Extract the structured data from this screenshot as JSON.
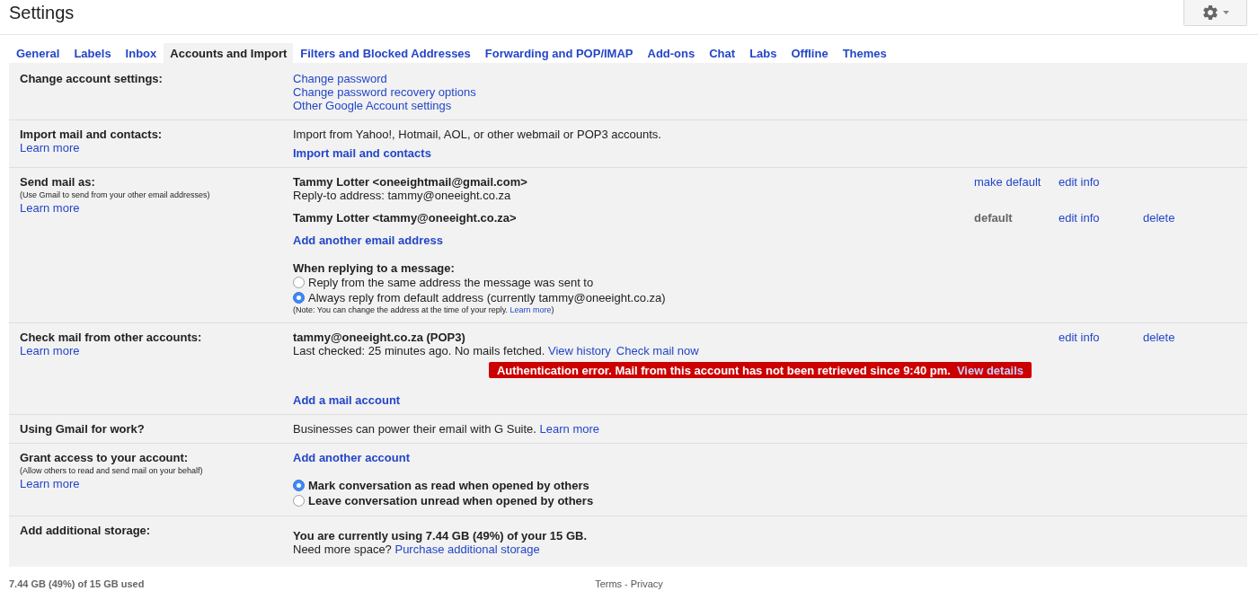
{
  "header": {
    "title": "Settings"
  },
  "tabs": [
    {
      "label": "General",
      "selected": false
    },
    {
      "label": "Labels",
      "selected": false
    },
    {
      "label": "Inbox",
      "selected": false
    },
    {
      "label": "Accounts and Import",
      "selected": true
    },
    {
      "label": "Filters and Blocked Addresses",
      "selected": false
    },
    {
      "label": "Forwarding and POP/IMAP",
      "selected": false
    },
    {
      "label": "Add-ons",
      "selected": false
    },
    {
      "label": "Chat",
      "selected": false
    },
    {
      "label": "Labs",
      "selected": false
    },
    {
      "label": "Offline",
      "selected": false
    },
    {
      "label": "Themes",
      "selected": false
    }
  ],
  "sections": [
    {
      "kind": "links",
      "label": "Change account settings:",
      "links": [
        "Change password",
        "Change password recovery options",
        "Other Google Account settings"
      ]
    },
    {
      "kind": "import",
      "label": "Import mail and contacts:",
      "learn_more": "Learn more",
      "text": "Import from Yahoo!, Hotmail, AOL, or other webmail or POP3 accounts.",
      "action": "Import mail and contacts"
    },
    {
      "kind": "send_as",
      "label": "Send mail as:",
      "note": "(Use Gmail to send from your other email addresses)",
      "learn_more": "Learn more",
      "senders": [
        {
          "name": "Tammy Lotter <oneeightmail@gmail.com>",
          "reply_to": "Reply-to address: tammy@oneeight.co.za",
          "actions": {
            "make_default": "make default",
            "edit_info": "edit info"
          }
        },
        {
          "name": "Tammy Lotter <tammy@oneeight.co.za>",
          "actions": {
            "default_status": "default",
            "edit_info": "edit info",
            "delete": "delete"
          }
        }
      ],
      "action": "Add another email address",
      "reply_setting": {
        "heading": "When replying to a message:",
        "options": [
          {
            "label": "Reply from the same address the message was sent to",
            "selected": false
          },
          {
            "label": "Always reply from default address (currently tammy@oneeight.co.za)",
            "selected": true
          }
        ],
        "note": {
          "text": "(Note: You can change the address at the time of your reply.",
          "link": "Learn more",
          "after": ")"
        }
      }
    },
    {
      "kind": "check_mail",
      "label": "Check mail from other accounts:",
      "learn_more": "Learn more",
      "accounts": [
        {
          "name": "tammy@oneeight.co.za (POP3)",
          "status": "Last checked: 25 minutes ago. No mails fetched.",
          "links": [
            "View history",
            "Check mail now"
          ],
          "actions": {
            "edit_info": "edit info",
            "delete": "delete"
          },
          "error": {
            "text": "Authentication error. Mail from this account has not been retrieved since 9:40 pm.",
            "link": "View details"
          }
        }
      ],
      "action": "Add a mail account"
    },
    {
      "kind": "work",
      "label": "Using Gmail for work?",
      "text": "Businesses can power their email with G Suite.",
      "link": "Learn more"
    },
    {
      "kind": "grant_access",
      "label": "Grant access to your account:",
      "note": "(Allow others to read and send mail on your behalf)",
      "learn_more": "Learn more",
      "action": "Add another account",
      "options": [
        {
          "label": "Mark conversation as read when opened by others",
          "selected": true
        },
        {
          "label": "Leave conversation unread when opened by others",
          "selected": false
        }
      ]
    },
    {
      "kind": "storage",
      "label": "Add additional storage:",
      "usage": "You are currently using 7.44 GB (49%) of your 15 GB.",
      "text": "Need more space?",
      "link": "Purchase additional storage"
    }
  ],
  "footer": {
    "usage": "7.44 GB (49%) of 15 GB used",
    "links": [
      "Terms",
      "Privacy"
    ],
    "separator": "-"
  }
}
